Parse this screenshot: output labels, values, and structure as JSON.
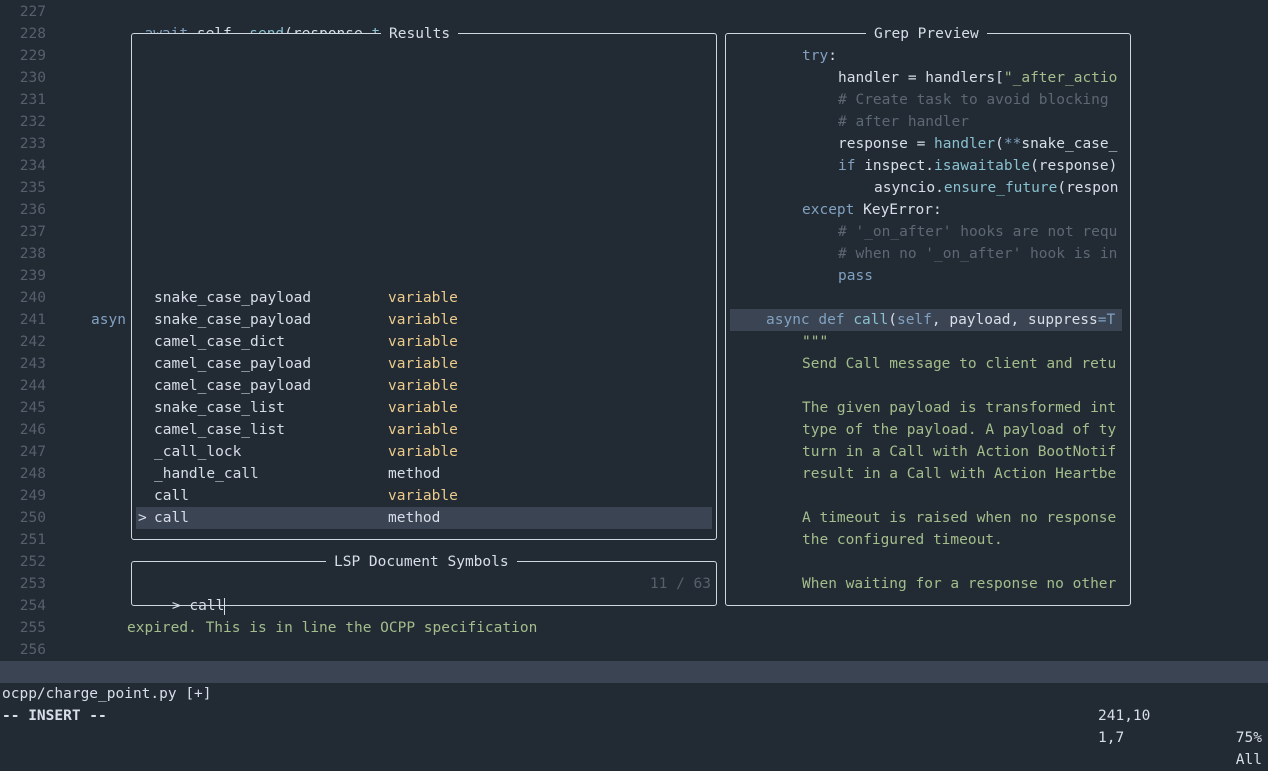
{
  "editor": {
    "line_numbers": [
      "227",
      "228",
      "229",
      "230",
      "231",
      "232",
      "233",
      "234",
      "235",
      "236",
      "237",
      "238",
      "239",
      "240",
      "241",
      "242",
      "243",
      "244",
      "245",
      "246",
      "247",
      "248",
      "249",
      "250",
      "251",
      "252",
      "253",
      "254",
      "255",
      "256"
    ],
    "line_227": {
      "kw": "await",
      "obj": "self.",
      "fn": "_send",
      "p1": "(response.",
      "fn2": "to_json",
      "p2": "())"
    },
    "line_241_fragment": "asyn",
    "line_255": "expired. This is in line the OCPP specification"
  },
  "results_panel": {
    "title": "Results",
    "items": [
      {
        "name": "snake_case_payload",
        "kind": "variable",
        "selected": false
      },
      {
        "name": "snake_case_payload",
        "kind": "variable",
        "selected": false
      },
      {
        "name": "camel_case_dict",
        "kind": "variable",
        "selected": false
      },
      {
        "name": "camel_case_payload",
        "kind": "variable",
        "selected": false
      },
      {
        "name": "camel_case_payload",
        "kind": "variable",
        "selected": false
      },
      {
        "name": "snake_case_list",
        "kind": "variable",
        "selected": false
      },
      {
        "name": "camel_case_list",
        "kind": "variable",
        "selected": false
      },
      {
        "name": "_call_lock",
        "kind": "variable",
        "selected": false
      },
      {
        "name": "_handle_call",
        "kind": "method",
        "selected": false
      },
      {
        "name": "call",
        "kind": "variable",
        "selected": false
      },
      {
        "name": "call",
        "kind": "method",
        "selected": true
      }
    ],
    "selection_marker": ">"
  },
  "prompt_panel": {
    "title": "LSP Document Symbols",
    "prompt_symbol": ">",
    "query": "call",
    "count": "11 / 63"
  },
  "preview_panel": {
    "title": "Grep Preview"
  },
  "statusline": {
    "filename": "ocpp/charge_point.py [+]",
    "position": "241,10",
    "percent": "75%",
    "mode": "-- INSERT --",
    "cmd_position": "1,7",
    "cmd_scope": "All"
  }
}
